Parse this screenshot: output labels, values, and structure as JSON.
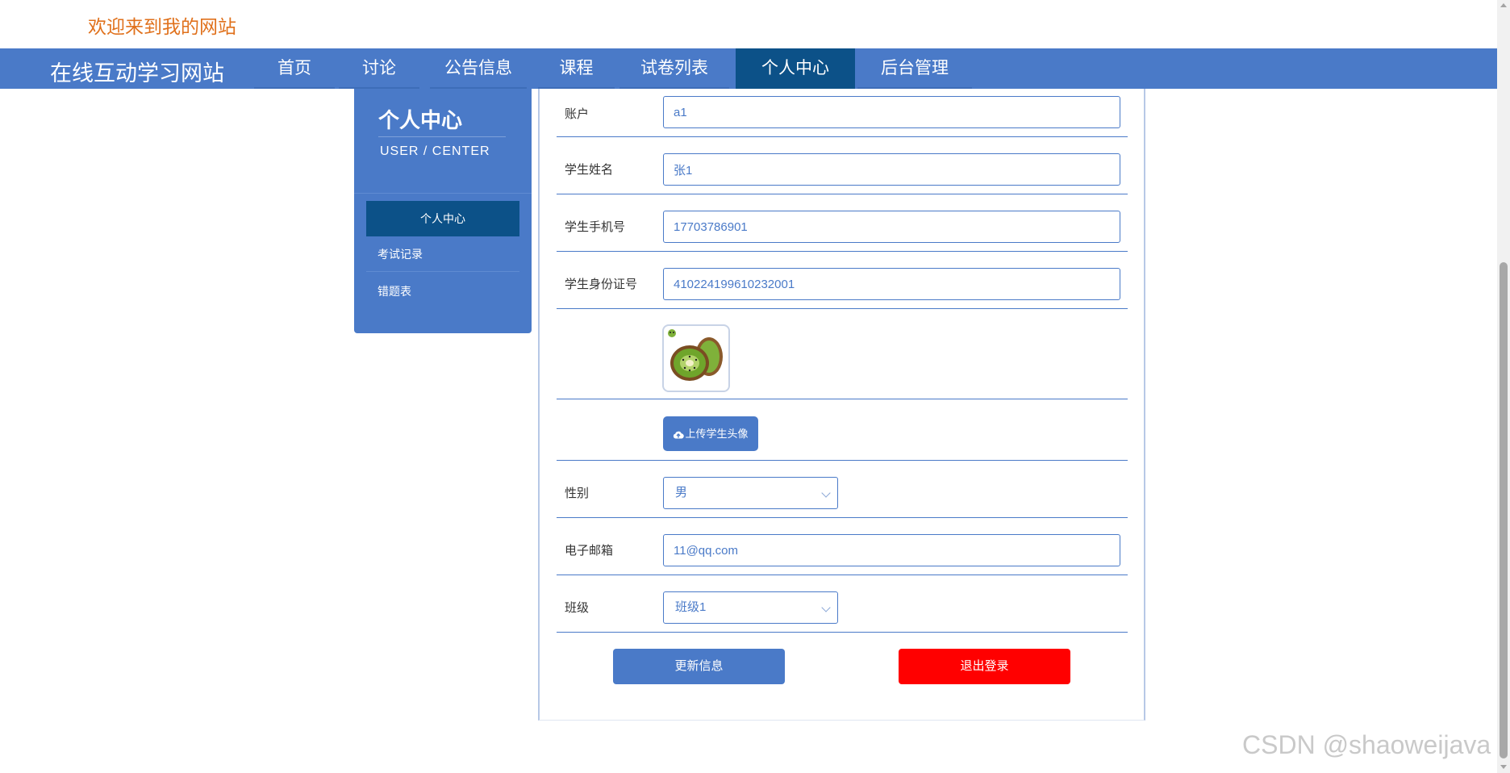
{
  "header": {
    "welcome": "欢迎来到我的网站"
  },
  "nav": {
    "brand": "在线互动学习网站",
    "items": [
      {
        "label": "首页"
      },
      {
        "label": "讨论"
      },
      {
        "label": "公告信息"
      },
      {
        "label": "课程"
      },
      {
        "label": "试卷列表"
      },
      {
        "label": "个人中心",
        "active": true
      },
      {
        "label": "后台管理"
      }
    ]
  },
  "sidebar": {
    "title": "个人中心",
    "subtitle": "USER / CENTER",
    "items": [
      {
        "label": "个人中心",
        "active": true
      },
      {
        "label": "考试记录"
      },
      {
        "label": "错题表"
      }
    ]
  },
  "form": {
    "account": {
      "label": "账户",
      "value": "a1"
    },
    "name": {
      "label": "学生姓名",
      "value": "张1"
    },
    "phone": {
      "label": "学生手机号",
      "value": "17703786901"
    },
    "id_card": {
      "label": "学生身份证号",
      "value": "410224199610232001"
    },
    "avatar": {
      "image": "kiwi-fruit"
    },
    "upload_label": "上传学生头像",
    "gender": {
      "label": "性别",
      "value": "男"
    },
    "email": {
      "label": "电子邮箱",
      "value": "11@qq.com"
    },
    "class": {
      "label": "班级",
      "value": "班级1"
    },
    "update_label": "更新信息",
    "logout_label": "退出登录"
  },
  "colors": {
    "primary": "#4a7ac8",
    "active": "#0c5188",
    "danger": "#ff0000",
    "welcome": "#e0711c"
  },
  "watermark": "CSDN @shaoweijava"
}
